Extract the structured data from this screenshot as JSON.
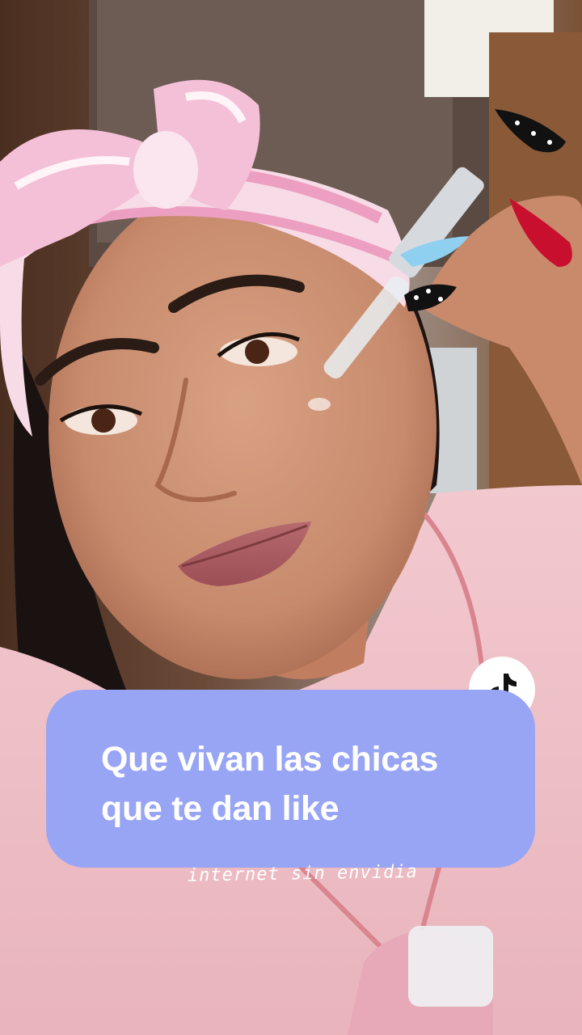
{
  "caption": {
    "line1": "Que vivan las chicas",
    "line2": "que te dan like",
    "background": "#98a4f4"
  },
  "overlay_text": "internet sin envidia",
  "icons": {
    "logo": "tiktok-logo-icon"
  },
  "colors": {
    "caption_text": "#ffffff",
    "logo_badge": "#ffffff"
  }
}
